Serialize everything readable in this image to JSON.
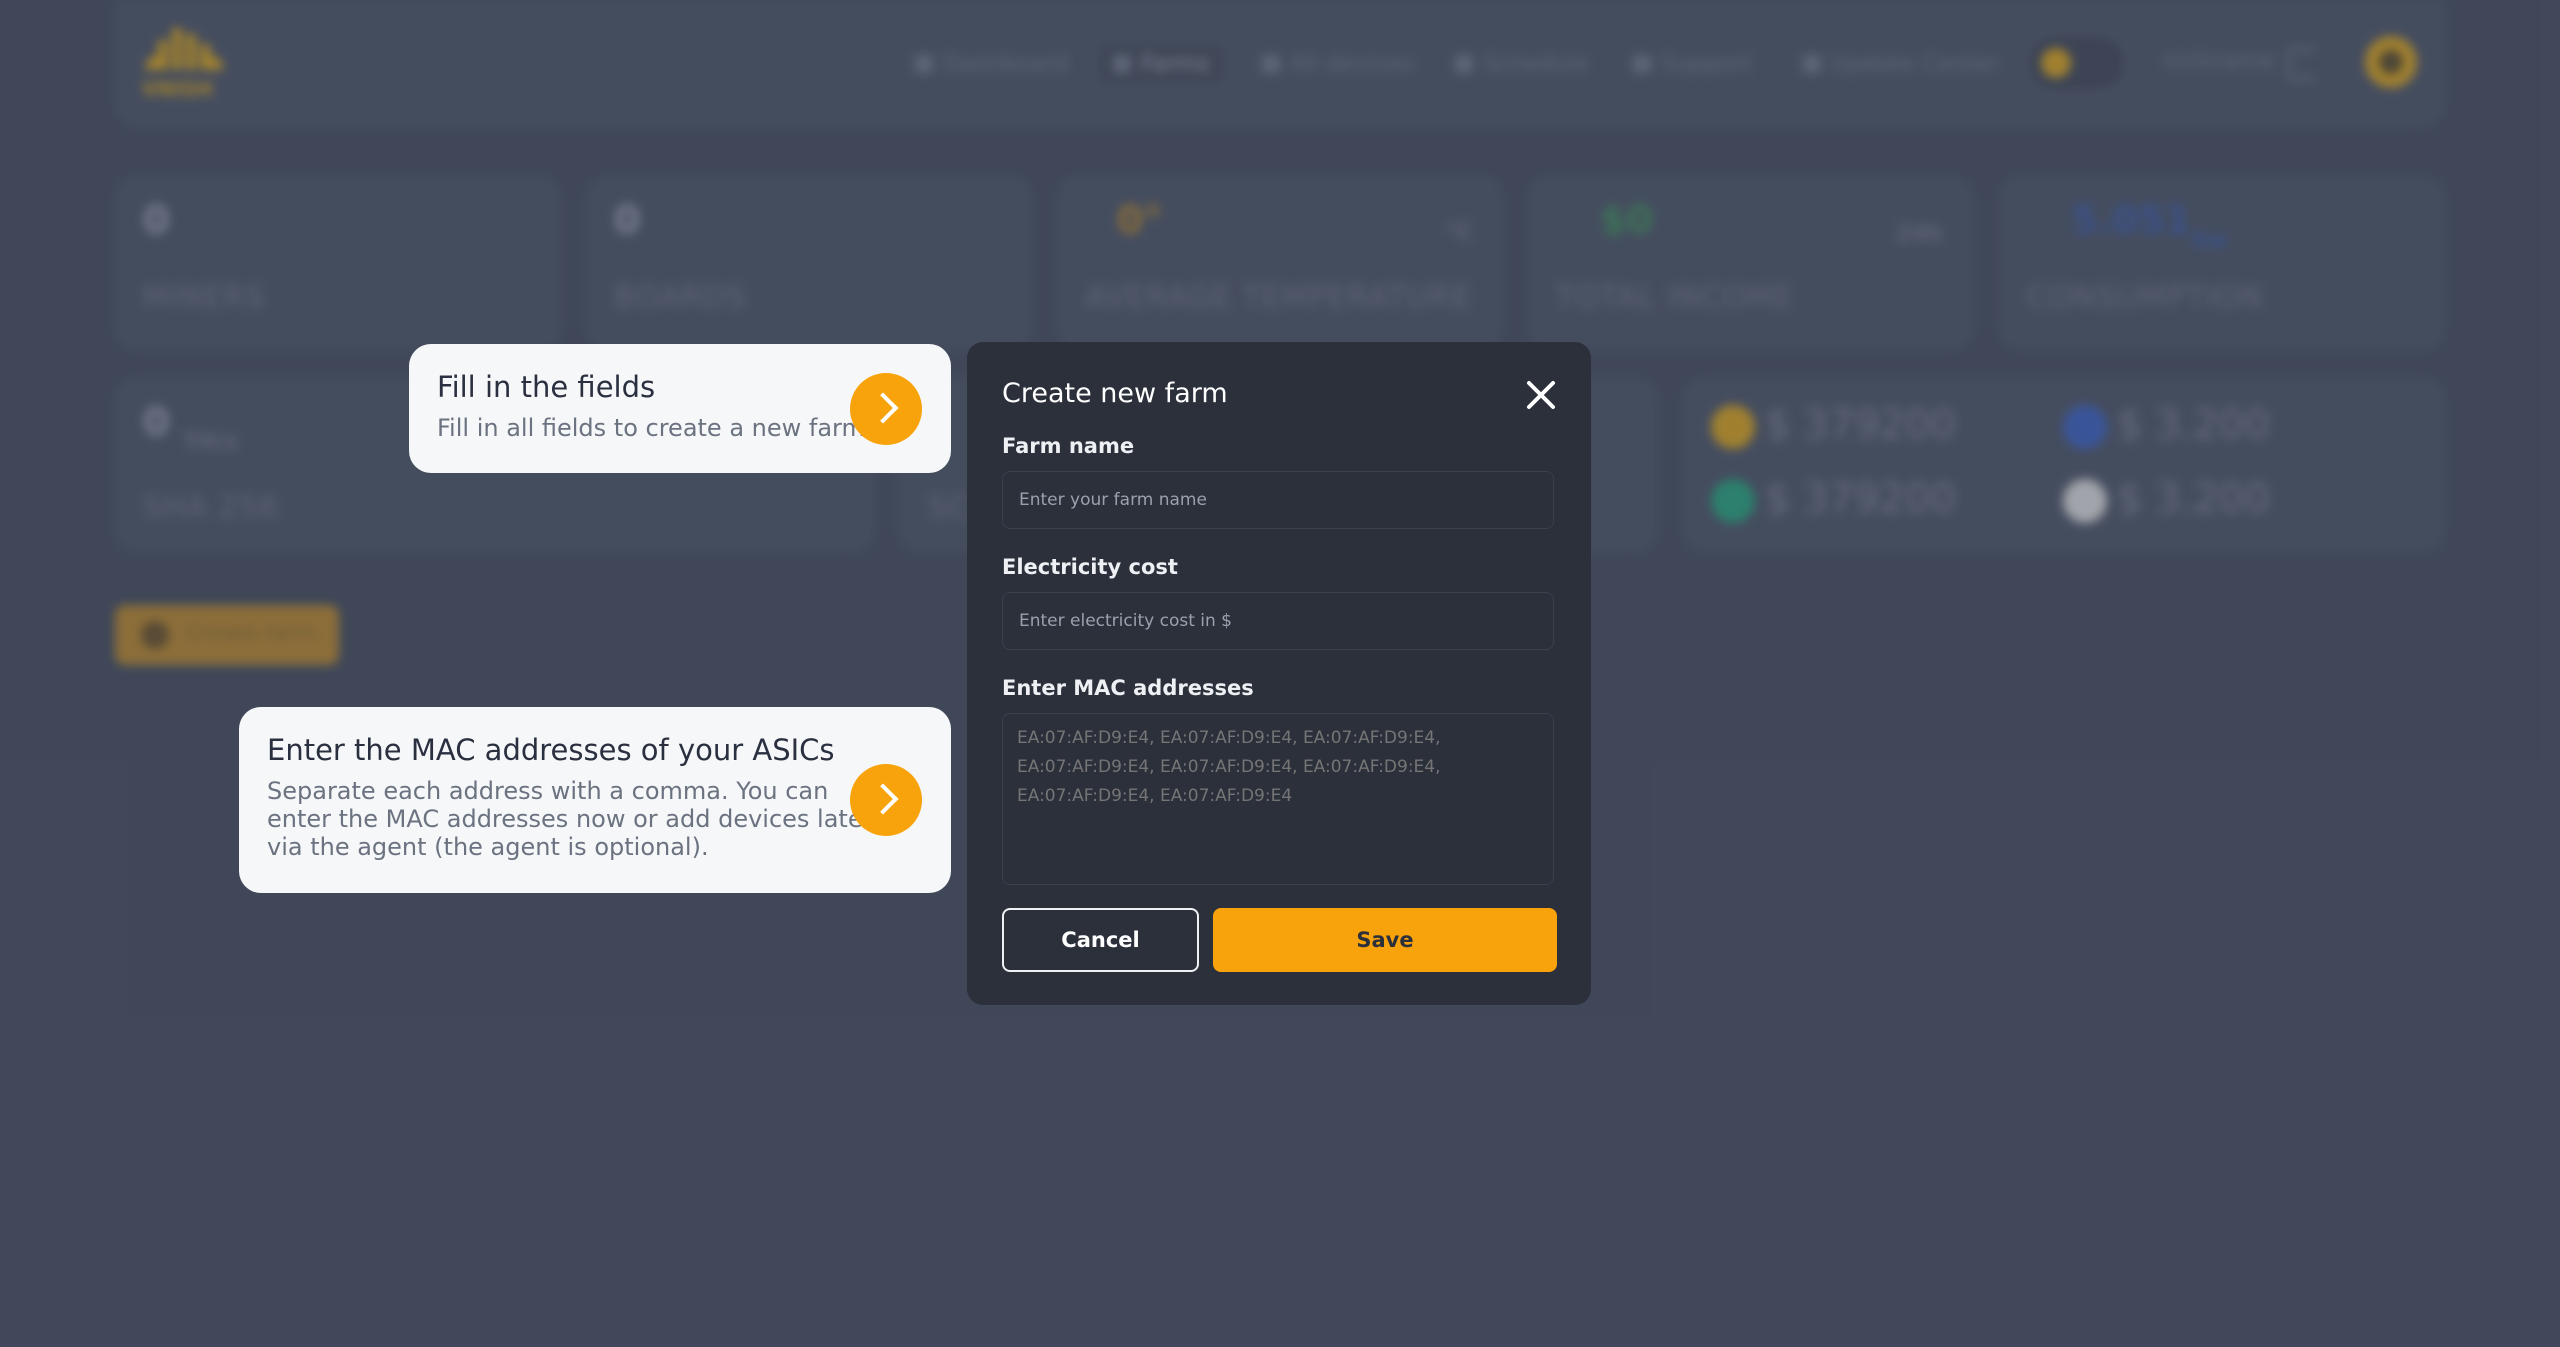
{
  "header": {
    "logo_text": "VNISH",
    "nav": [
      {
        "label": "Dashboard",
        "icon": "dashboard-icon"
      },
      {
        "label": "Farms",
        "icon": "share-icon",
        "active": true
      },
      {
        "label": "All devices",
        "icon": "lightning-icon"
      },
      {
        "label": "Schedule",
        "icon": "calendar-icon"
      },
      {
        "label": "Support",
        "icon": "chat-icon"
      },
      {
        "label": "Update Center",
        "icon": "gear-icon"
      }
    ],
    "nickname": "nickname"
  },
  "stats": [
    {
      "value": "0",
      "label": "MINERS"
    },
    {
      "value": "0",
      "label": "BOARDS"
    },
    {
      "value": "0°",
      "label": "AVERAGE TEMPERATURE",
      "unit": "°C"
    },
    {
      "value": "$0",
      "label": "TOTAL INCOME",
      "unit": "24h"
    },
    {
      "value": "5.051",
      "label": "CONSUMPTION",
      "unit": "kw"
    }
  ],
  "hashrate": [
    {
      "value": "0",
      "unit": "TH/s",
      "label": "SHA 256"
    },
    {
      "label": "SC"
    }
  ],
  "coins": [
    {
      "value": "$ 379200",
      "color": "#d7a21d",
      "icon": "dogecoin-icon"
    },
    {
      "value": "$ 3.200",
      "color": "#3b5fc0",
      "icon": "litecoin-icon"
    },
    {
      "value": "$ 379200",
      "color": "#26a17b",
      "icon": "coin-icon"
    },
    {
      "value": "$ 3.200",
      "color": "#d9d9d9",
      "icon": "coin-icon"
    }
  ],
  "create_farm_label": "Create farm",
  "tips": [
    {
      "title": "Fill in the fields",
      "lines": [
        "Fill in all fields to create a new farm"
      ]
    },
    {
      "title": "Enter the MAC addresses of your ASICs",
      "lines": [
        "Separate each address with a comma. You can",
        "enter the MAC addresses now or add devices later",
        "via the agent (the agent is optional)."
      ]
    }
  ],
  "modal": {
    "title": "Create new farm",
    "farm_name_label": "Farm name",
    "farm_name_placeholder": "Enter your farm name",
    "electricity_label": "Electricity cost",
    "electricity_placeholder": "Enter electricity cost in $",
    "mac_label": "Enter MAC addresses",
    "mac_placeholder": "EA:07:AF:D9:E4, EA:07:AF:D9:E4, EA:07:AF:D9:E4, EA:07:AF:D9:E4, EA:07:AF:D9:E4, EA:07:AF:D9:E4, EA:07:AF:D9:E4, EA:07:AF:D9:E4",
    "cancel_label": "Cancel",
    "save_label": "Save"
  },
  "colors": {
    "accent": "#f8a30c",
    "background": "#434b5c",
    "modal": "#2b303b"
  }
}
